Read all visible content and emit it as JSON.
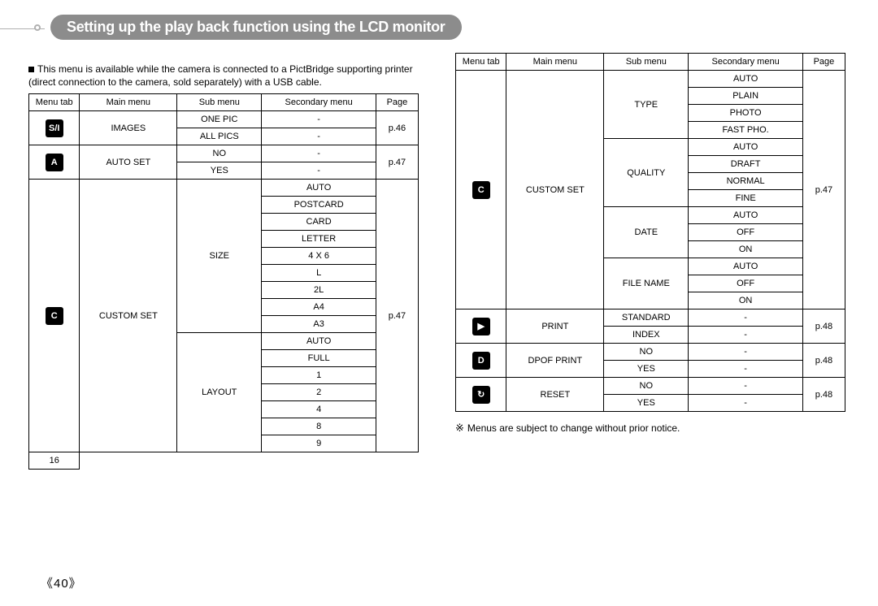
{
  "title": "Setting up the play back function using the LCD monitor",
  "intro": "This menu is available while the camera is connected to a PictBridge supporting printer (direct connection to the camera, sold separately) with a USB cable.",
  "footnote_mark": "※",
  "footnote_text": "Menus are subject to change without prior notice.",
  "page_number": "《40》",
  "headers": [
    "Menu tab",
    "Main menu",
    "Sub menu",
    "Secondary menu",
    "Page"
  ],
  "left_body": [
    {
      "icon": "S/I",
      "icon_rows": 2,
      "main": "IMAGES",
      "main_rows": 2,
      "sub": "ONE PIC",
      "sec": "-",
      "page": "p.46",
      "page_rows": 2
    },
    {
      "sub": "ALL PICS",
      "sec": "-"
    },
    {
      "icon": "A",
      "icon_rows": 2,
      "main": "AUTO SET",
      "main_rows": 2,
      "sub": "NO",
      "sec": "-",
      "page": "p.47",
      "page_rows": 2
    },
    {
      "sub": "YES",
      "sec": "-"
    },
    {
      "icon": "C",
      "icon_rows": 16,
      "main": "CUSTOM SET",
      "main_rows": 16,
      "sub": "SIZE",
      "sub_rows": 9,
      "sec": "AUTO",
      "page": "p.47",
      "page_rows": 16
    },
    {
      "sec": "POSTCARD"
    },
    {
      "sec": "CARD"
    },
    {
      "sec": "LETTER"
    },
    {
      "sec": "4 X 6"
    },
    {
      "sec": "L"
    },
    {
      "sec": "2L"
    },
    {
      "sec": "A4"
    },
    {
      "sec": "A3"
    },
    {
      "sub": "LAYOUT",
      "sub_rows": 7,
      "sec": "AUTO"
    },
    {
      "sec": "FULL"
    },
    {
      "sec": "1"
    },
    {
      "sec": "2"
    },
    {
      "sec": "4"
    },
    {
      "sec": "8"
    },
    {
      "sec": "9"
    },
    {
      "sec": "16"
    }
  ],
  "right_body": [
    {
      "icon": "C",
      "icon_rows": 14,
      "main": "CUSTOM SET",
      "main_rows": 14,
      "sub": "TYPE",
      "sub_rows": 4,
      "sec": "AUTO",
      "page": "p.47",
      "page_rows": 14
    },
    {
      "sec": "PLAIN"
    },
    {
      "sec": "PHOTO"
    },
    {
      "sec": "FAST PHO."
    },
    {
      "sub": "QUALITY",
      "sub_rows": 4,
      "sec": "AUTO"
    },
    {
      "sec": "DRAFT"
    },
    {
      "sec": "NORMAL"
    },
    {
      "sec": "FINE"
    },
    {
      "sub": "DATE",
      "sub_rows": 3,
      "sec": "AUTO"
    },
    {
      "sec": "OFF"
    },
    {
      "sec": "ON"
    },
    {
      "sub": "FILE NAME",
      "sub_rows": 3,
      "sec": "AUTO"
    },
    {
      "sec": "OFF"
    },
    {
      "sec": "ON"
    },
    {
      "icon": "▶",
      "icon_rows": 2,
      "main": "PRINT",
      "main_rows": 2,
      "sub": "STANDARD",
      "sec": "-",
      "page": "p.48",
      "page_rows": 2
    },
    {
      "sub": "INDEX",
      "sec": "-"
    },
    {
      "icon": "D",
      "icon_rows": 2,
      "main": "DPOF PRINT",
      "main_rows": 2,
      "sub": "NO",
      "sec": "-",
      "page": "p.48",
      "page_rows": 2
    },
    {
      "sub": "YES",
      "sec": "-"
    },
    {
      "icon": "↻",
      "icon_rows": 2,
      "main": "RESET",
      "main_rows": 2,
      "sub": "NO",
      "sec": "-",
      "page": "p.48",
      "page_rows": 2
    },
    {
      "sub": "YES",
      "sec": "-"
    }
  ]
}
